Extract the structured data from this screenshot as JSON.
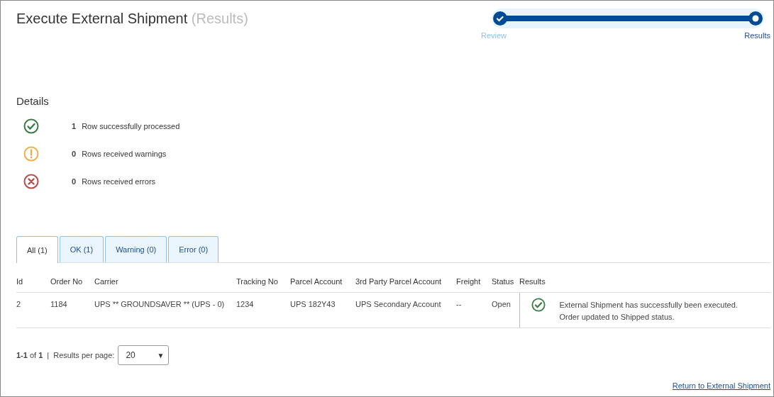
{
  "header": {
    "title": "Execute External Shipment",
    "subtitle": "(Results)"
  },
  "stepper": {
    "steps": [
      {
        "label": "Review",
        "completed": true,
        "selected": false
      },
      {
        "label": "Results",
        "completed": false,
        "selected": true
      }
    ]
  },
  "details": {
    "heading": "Details",
    "items": [
      {
        "kind": "success",
        "count": "1",
        "label": "Row successfully processed"
      },
      {
        "kind": "warning",
        "count": "0",
        "label": "Rows received warnings"
      },
      {
        "kind": "error",
        "count": "0",
        "label": "Rows received errors"
      }
    ]
  },
  "tabs": [
    {
      "label": "All (1)",
      "selected": true
    },
    {
      "label": "OK (1)",
      "selected": false
    },
    {
      "label": "Warning (0)",
      "selected": false
    },
    {
      "label": "Error (0)",
      "selected": false
    }
  ],
  "table": {
    "columns": [
      "Id",
      "Order No",
      "Carrier",
      "Tracking No",
      "Parcel Account",
      "3rd Party Parcel Account",
      "Freight",
      "Status",
      "Results"
    ],
    "rows": [
      {
        "cells": [
          "2",
          "1184",
          "UPS ** GROUNDSAVER ** (UPS - 0)",
          "1234",
          "UPS 182Y43",
          "UPS Secondary Account",
          "--",
          "Open"
        ],
        "kind": "success",
        "result_lines": [
          "External Shipment has successfully been executed.",
          "Order updated to Shipped status."
        ]
      }
    ]
  },
  "pagination": {
    "range": "**1-1** of **1**",
    "separator": "|",
    "per_page_label": "Results per page:",
    "per_page": "20",
    "caret": "▼"
  },
  "return_link": "Return to External Shipment"
}
